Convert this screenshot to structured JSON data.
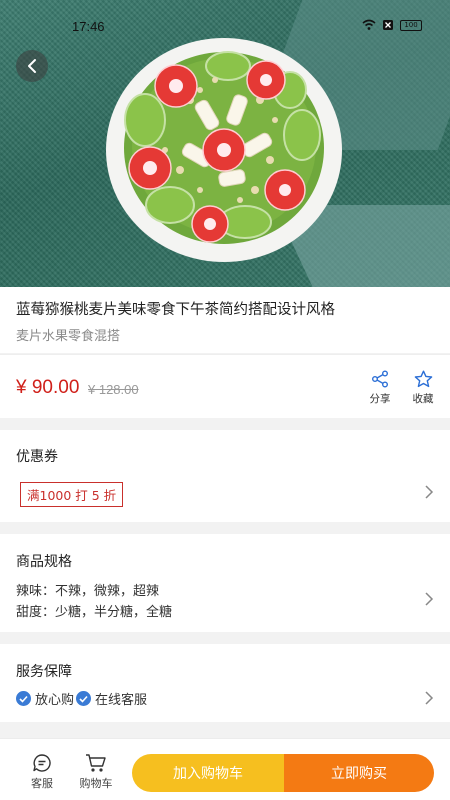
{
  "status_bar": {
    "time": "17:46",
    "battery": "100"
  },
  "product": {
    "title": "蓝莓猕猴桃麦片美味零食下午茶简约搭配设计风格",
    "subtitle": "麦片水果零食混搭",
    "price": "¥ 90.00",
    "original_price": "¥ 128.00"
  },
  "actions": {
    "share_label": "分享",
    "favorite_label": "收藏"
  },
  "coupon": {
    "title": "优惠券",
    "tag": "满1000 打 5 折"
  },
  "spec": {
    "title": "商品规格",
    "lines": [
      "辣味：不辣，微辣，超辣",
      "甜度：少糖，半分糖，全糖"
    ]
  },
  "service": {
    "title": "服务保障",
    "items": [
      "放心购",
      "在线客服"
    ]
  },
  "bottom_bar": {
    "service_label": "客服",
    "cart_label": "购物车",
    "add_to_cart": "加入购物车",
    "buy_now": "立即购买"
  },
  "colors": {
    "price": "#d0201a",
    "cart_button": "#f6bf1f",
    "buy_button": "#f47a13",
    "check": "#3a7bd5"
  },
  "icons": [
    "back-icon",
    "share-icon",
    "star-icon",
    "chevron-right-icon",
    "check-icon",
    "chat-icon",
    "cart-icon"
  ]
}
